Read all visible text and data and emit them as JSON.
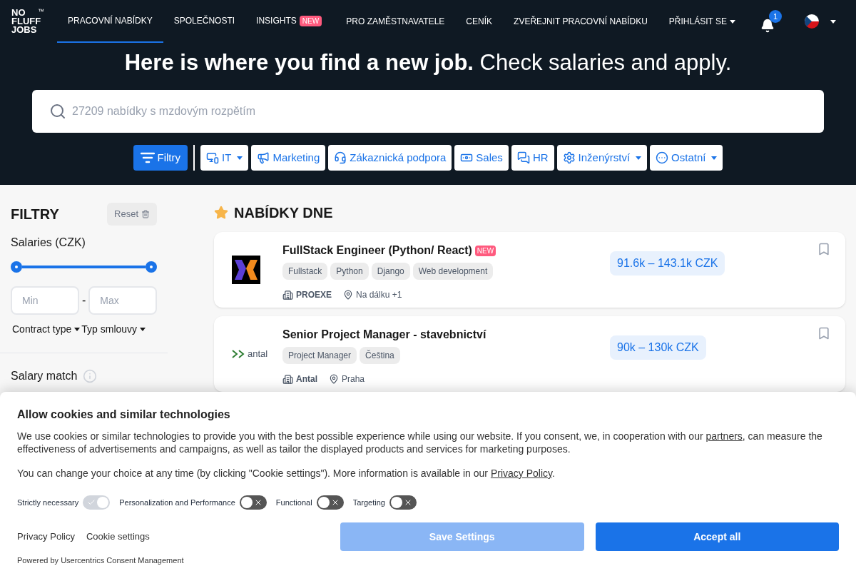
{
  "nav": {
    "logo": [
      "NO",
      "FLUFF",
      "JOBS"
    ],
    "logo_mark": "™",
    "items": [
      {
        "label": "PRACOVNÍ NABÍDKY",
        "selected": true
      },
      {
        "label": "SPOLEČNOSTI",
        "selected": false
      },
      {
        "label": "INSIGHTS",
        "selected": false,
        "badge": "NEW"
      }
    ],
    "right_items": [
      {
        "label": "PRO ZAMĚSTNAVATELE",
        "dropdown": false
      },
      {
        "label": "CENÍK",
        "dropdown": false
      },
      {
        "label": "ZVEŘEJNIT PRACOVNÍ NABÍDKU",
        "dropdown": false
      },
      {
        "label": "PŘIHLÁSIT SE",
        "dropdown": true
      }
    ],
    "notifications": "1"
  },
  "hero": {
    "title_bold": "Here is where you find a new job.",
    "title_rest": "Check salaries and apply.",
    "search": {
      "placeholder": "27209 nabídky s mzdovým rozpětím"
    },
    "filter_button": "Filtry",
    "categories": [
      {
        "label": "IT",
        "dropdown": true
      },
      {
        "label": "Marketing",
        "dropdown": false
      },
      {
        "label": "Zákaznická podpora",
        "dropdown": false
      },
      {
        "label": "Sales",
        "dropdown": false
      },
      {
        "label": "HR",
        "dropdown": false
      },
      {
        "label": "Inženýrství",
        "dropdown": true
      },
      {
        "label": "Ostatní",
        "dropdown": true
      }
    ]
  },
  "sidebar": {
    "title": "FILTRY",
    "reset": "Reset",
    "salaries_label": "Salaries (CZK)",
    "slider": {
      "level": 1
    },
    "min": {
      "placeholder": "Min"
    },
    "separator": "-",
    "max": {
      "placeholder": "Max"
    },
    "dropdowns": [
      "Contract type",
      "Typ smlouvy"
    ],
    "salary_match": "Salary match"
  },
  "offers": {
    "title": "NABÍDKY DNE",
    "jobs": [
      {
        "title": "FullStack Engineer (Python/ React)",
        "badge": "NEW",
        "tags": [
          "Fullstack",
          "Python",
          "Django",
          "Web development"
        ],
        "company": "PROEXE",
        "location": "Na dálku +1",
        "salary": "91.6k – 143.1k CZK"
      },
      {
        "title": "Senior Project Manager - stavebnictví",
        "logo_text": "antal",
        "tags": [
          "Project Manager",
          "Čeština"
        ],
        "company": "Antal",
        "location": "Praha",
        "salary": "90k – 130k CZK"
      }
    ]
  },
  "cookie_banner": {
    "title": "Allow cookies and similar technologies",
    "text_before": "We use cookies or similar technologies to provide you with the best possible experience while using our website. If you consent, we, in cooperation with our",
    "partners_link": "partners",
    "text_after": ", can measure the effectiveness of advertisements and campaigns, as well as tailor the displayed products and services for marketing purposes.",
    "text2_before": "You can change your choice at any time (by clicking \"Cookie settings\"). More information is available in our",
    "privacy_link": "Privacy Policy",
    "text2_after": ".",
    "toggles": [
      {
        "label": "Strictly necessary",
        "on": true,
        "disabled": true
      },
      {
        "label": "Personalization and Performance",
        "on": false,
        "disabled": false
      },
      {
        "label": "Functional",
        "on": false,
        "disabled": false
      },
      {
        "label": "Targeting",
        "on": false,
        "disabled": false
      }
    ],
    "links": [
      "Privacy Policy",
      "Cookie settings"
    ],
    "powered_by": "Powered by Usercentrics Consent Management",
    "buttons": [
      {
        "label": "Save Settings",
        "kind": "secondary"
      },
      {
        "label": "Accept all",
        "kind": "primary"
      }
    ]
  }
}
